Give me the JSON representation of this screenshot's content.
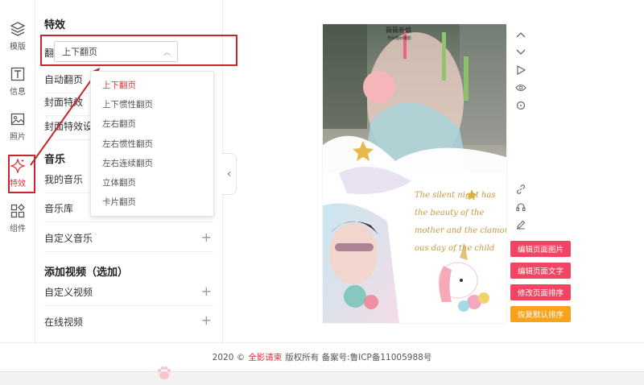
{
  "rail": {
    "items": [
      {
        "label": "模版",
        "icon": "layers-icon"
      },
      {
        "label": "信息",
        "icon": "text-icon"
      },
      {
        "label": "照片",
        "icon": "image-icon"
      },
      {
        "label": "特效",
        "icon": "sparkle-icon"
      },
      {
        "label": "组件",
        "icon": "components-icon"
      }
    ],
    "active_color": "#e0323f"
  },
  "effects": {
    "title": "特效",
    "page_flip_label": "翻页特效",
    "page_flip_value": "上下翻页",
    "auto_flip_label": "自动翻页",
    "cover_effect_label": "封面特效",
    "cover_effect_setting_label": "封面特效设",
    "options": [
      "上下翻页",
      "上下惯性翻页",
      "左右翻页",
      "左右惯性翻页",
      "左右连续翻页",
      "立体翻页",
      "卡片翻页"
    ]
  },
  "music": {
    "title": "音乐",
    "my_music": "我的音乐",
    "library": "音乐库",
    "custom": "自定义音乐"
  },
  "video": {
    "title": "添加视频（选加）",
    "custom": "自定义视频",
    "online": "在线视频"
  },
  "preview": {
    "header_line1": "薇薇新娘",
    "header_line2": "苏州婚纱摄影",
    "poem": [
      "The silent night has",
      "the beauty of the",
      "mother and the clamor-",
      "ous day of the child"
    ]
  },
  "actions": {
    "edit_photo": "编辑页面图片",
    "edit_text": "编辑页面文字",
    "edit_order": "修改页面排序",
    "restore_order": "恢复默认排序"
  },
  "footer": {
    "prefix": "2020 ©",
    "brand": "全影请柬",
    "suffix": "版权所有 备案号:鲁ICP备11005988号"
  },
  "colors": {
    "accent": "#e0323f",
    "highlight_box": "#c8262e",
    "button_pink": "#f04664",
    "button_orange": "#f7a21b"
  }
}
